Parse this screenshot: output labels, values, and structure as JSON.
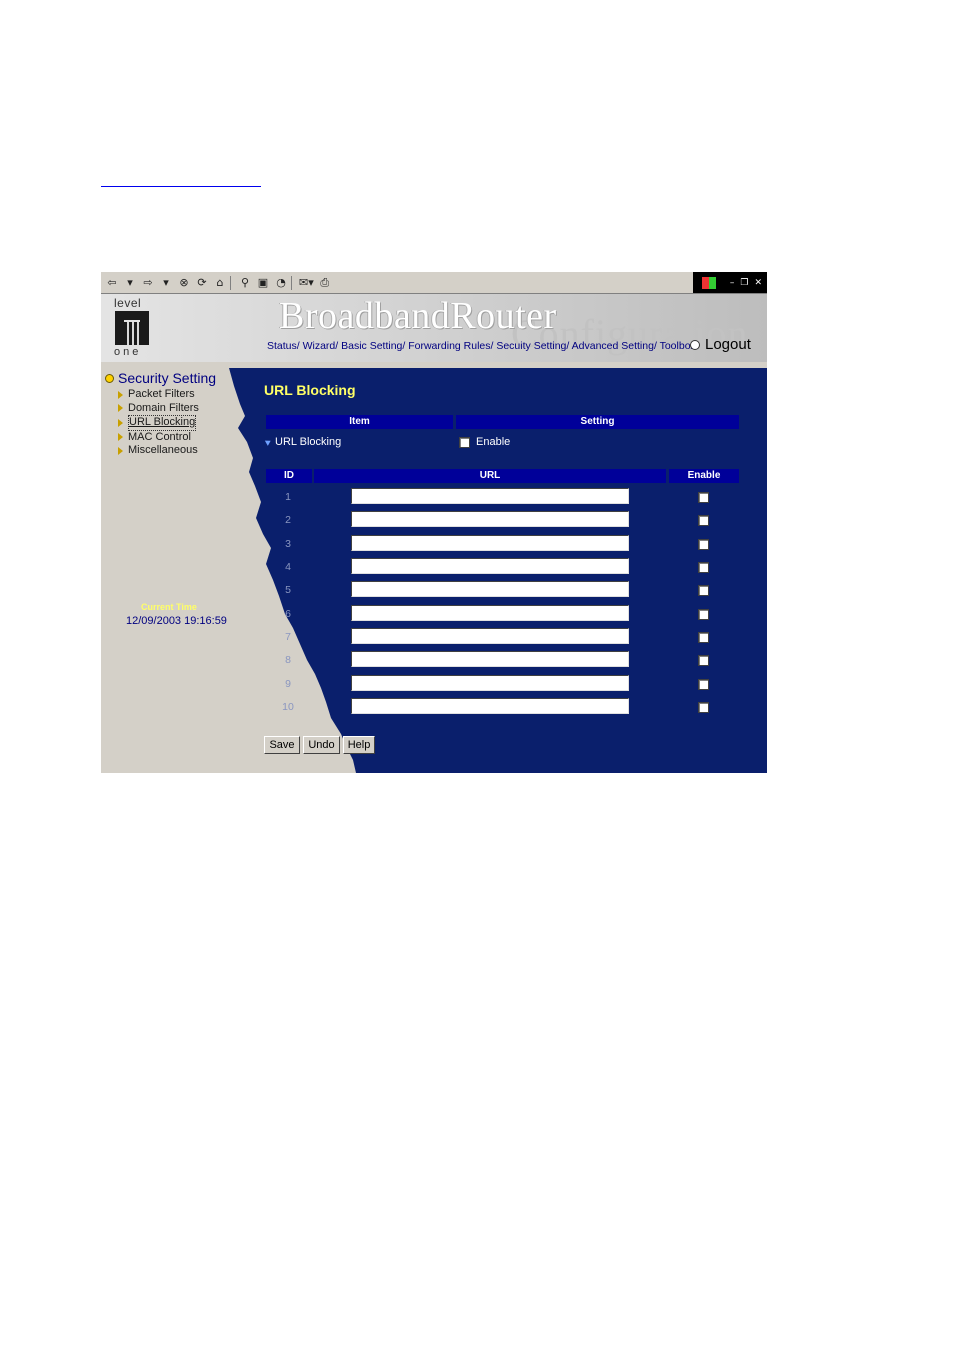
{
  "banner": {
    "logo_top": "level",
    "logo_bottom": "one",
    "brand": "BroadbandRouter",
    "brand_sub": "Configuration",
    "nav": "Status/ Wizard/ Basic Setting/ Forwarding Rules/ Secuity Setting/ Advanced Setting/ Toolbox",
    "logout": "Logout"
  },
  "sidebar": {
    "section_title": "Security Setting",
    "items": [
      {
        "label": "Packet Filters"
      },
      {
        "label": "Domain Filters"
      },
      {
        "label": "URL Blocking",
        "active": true
      },
      {
        "label": "MAC Control"
      },
      {
        "label": "Miscellaneous"
      }
    ],
    "time_label": "Current Time",
    "time_value": "12/09/2003 19:16:59"
  },
  "main": {
    "title": "URL Blocking",
    "headers": {
      "item": "Item",
      "setting": "Setting"
    },
    "feature": {
      "label": "URL Blocking",
      "enable_label": "Enable",
      "enabled": false
    },
    "table_headers": {
      "id": "ID",
      "url": "URL",
      "enable": "Enable"
    },
    "rows": [
      {
        "id": "1",
        "url": "",
        "enabled": false
      },
      {
        "id": "2",
        "url": "",
        "enabled": false
      },
      {
        "id": "3",
        "url": "",
        "enabled": false
      },
      {
        "id": "4",
        "url": "",
        "enabled": false
      },
      {
        "id": "5",
        "url": "",
        "enabled": false
      },
      {
        "id": "6",
        "url": "",
        "enabled": false
      },
      {
        "id": "7",
        "url": "",
        "enabled": false
      },
      {
        "id": "8",
        "url": "",
        "enabled": false
      },
      {
        "id": "9",
        "url": "",
        "enabled": false
      },
      {
        "id": "10",
        "url": "",
        "enabled": false
      }
    ],
    "buttons": {
      "save": "Save",
      "undo": "Undo",
      "help": "Help"
    }
  },
  "colors": {
    "content_bg": "#0a1f6c",
    "header_bg": "#000099",
    "title_yellow": "#ffff66",
    "sidebar_bg": "#d4d0c8"
  },
  "toolbar": {
    "icons": [
      "back-icon",
      "dropdown-icon",
      "forward-icon",
      "dropdown-icon",
      "stop-icon",
      "refresh-icon",
      "home-icon",
      "search-icon",
      "favorites-icon",
      "history-icon",
      "mail-icon",
      "print-icon"
    ]
  }
}
